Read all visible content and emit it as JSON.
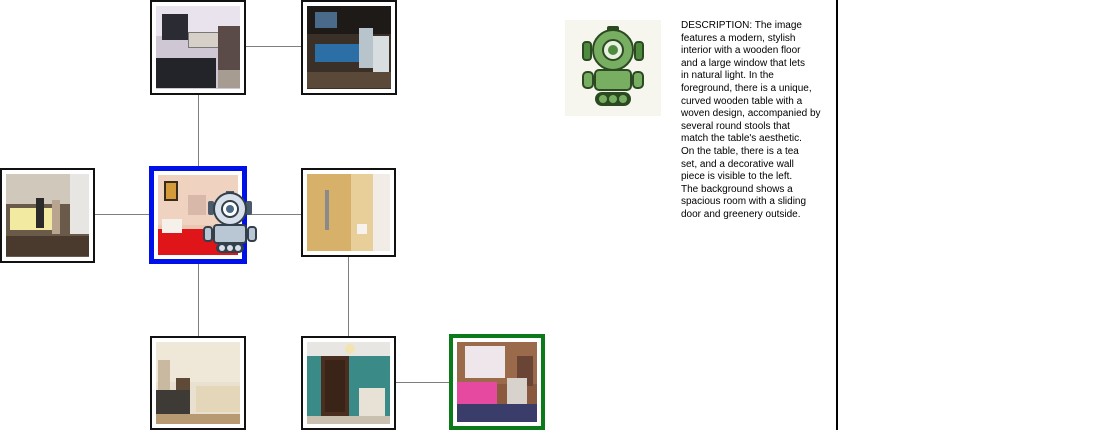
{
  "graph": {
    "nodes": [
      {
        "id": "room-top-left",
        "scene": "bar-shelves"
      },
      {
        "id": "room-top-right",
        "scene": "game-room"
      },
      {
        "id": "room-left",
        "scene": "lobby"
      },
      {
        "id": "room-center",
        "scene": "red-bedroom",
        "status": "current"
      },
      {
        "id": "room-right",
        "scene": "beige-bathroom"
      },
      {
        "id": "room-bottom-left",
        "scene": "living-room"
      },
      {
        "id": "room-bottom-mid",
        "scene": "teal-nursery"
      },
      {
        "id": "room-bottom-right",
        "scene": "pink-bedroom",
        "status": "goal"
      }
    ],
    "edges": [
      [
        "room-top-left",
        "room-top-right"
      ],
      [
        "room-top-left",
        "room-center"
      ],
      [
        "room-left",
        "room-center"
      ],
      [
        "room-center",
        "room-right"
      ],
      [
        "room-center",
        "room-bottom-left"
      ],
      [
        "room-right",
        "room-bottom-mid"
      ],
      [
        "room-bottom-mid",
        "room-bottom-right"
      ]
    ],
    "colors": {
      "current_border": "#0010e8",
      "goal_border": "#0a7a1a",
      "edge": "#7f7f7f",
      "agent": "#4a5a6a",
      "agent_panel": "#4f8a3f"
    },
    "agent_icon": "robot-icon"
  },
  "panel": {
    "robot_icon": "robot-icon",
    "description_lines": [
      "DESCRIPTION: The image",
      "features a modern, stylish",
      "interior with a wooden floor",
      "and a large window that lets",
      "in natural light. In the",
      "foreground, there is a unique,",
      "curved wooden table with a",
      "woven design, accompanied by",
      "several round stools that",
      "match the table's aesthetic.",
      "On the table, there is a tea",
      "set, and a decorative wall",
      "piece is visible to the left.",
      "The background shows a",
      "spacious room with a sliding",
      "door and greenery outside."
    ]
  }
}
